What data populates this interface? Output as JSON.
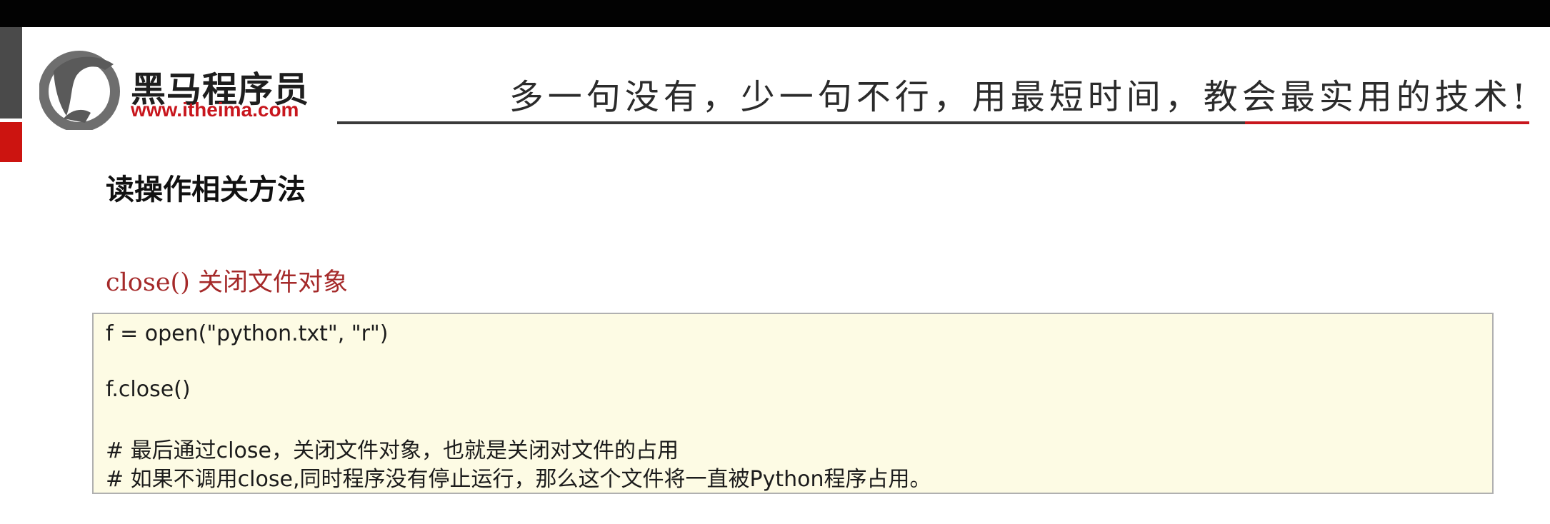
{
  "brand": {
    "name": "黑马程序员",
    "url": "www.itheima.com",
    "slogan": "多一句没有，少一句不行，用最短时间，教会最实用的技术!"
  },
  "slide": {
    "heading": "读操作相关方法",
    "subheading": "close() 关闭文件对象"
  },
  "code": {
    "lines": [
      "f = open(\"python.txt\", \"r\")",
      "f.close()",
      "# 最后通过close，关闭文件对象，也就是关闭对文件的占用",
      "# 如果不调用close,同时程序没有停止运行，那么这个文件将一直被Python程序占用。"
    ]
  },
  "colors": {
    "brand_red": "#c8161d",
    "code_background": "#fdfbe4",
    "subheading_color": "#a52a2a"
  }
}
